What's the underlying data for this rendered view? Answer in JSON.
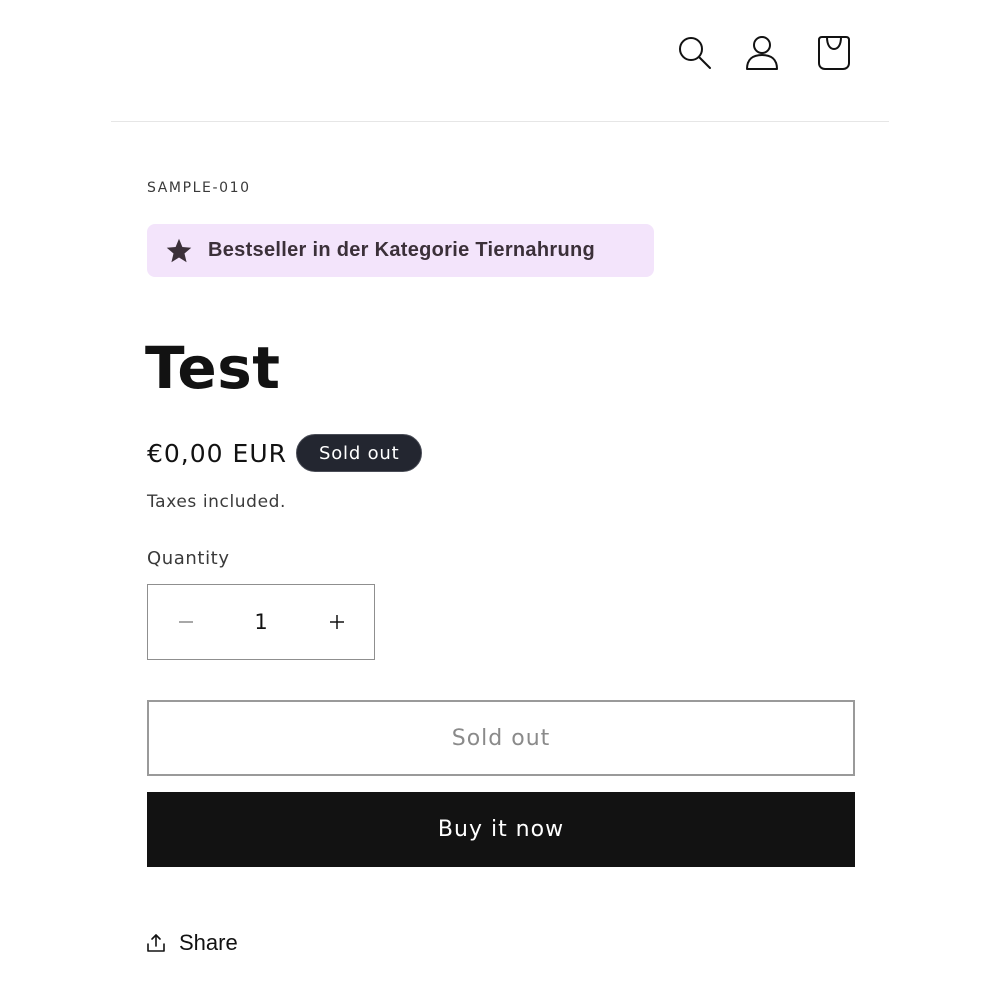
{
  "header": {
    "icons": [
      "search-icon",
      "account-icon",
      "cart-icon"
    ]
  },
  "product": {
    "sku": "SAMPLE-010",
    "bestseller_badge": "Bestseller in der Kategorie Tiernahrung",
    "bestseller_icon": "star-icon",
    "title": "Test",
    "price": "€0,00 EUR",
    "status_badge": "Sold out",
    "taxes_note": "Taxes included."
  },
  "quantity": {
    "label": "Quantity",
    "value": "1",
    "decrease_icon": "minus-icon",
    "increase_icon": "plus-icon"
  },
  "buttons": {
    "add_to_cart_label": "Sold out",
    "buy_now_label": "Buy it now"
  },
  "share": {
    "label": "Share",
    "icon": "share-icon"
  },
  "colors": {
    "badge_background": "#f3e4fb",
    "sold_out_badge": "#232630",
    "buy_button": "#121212"
  }
}
